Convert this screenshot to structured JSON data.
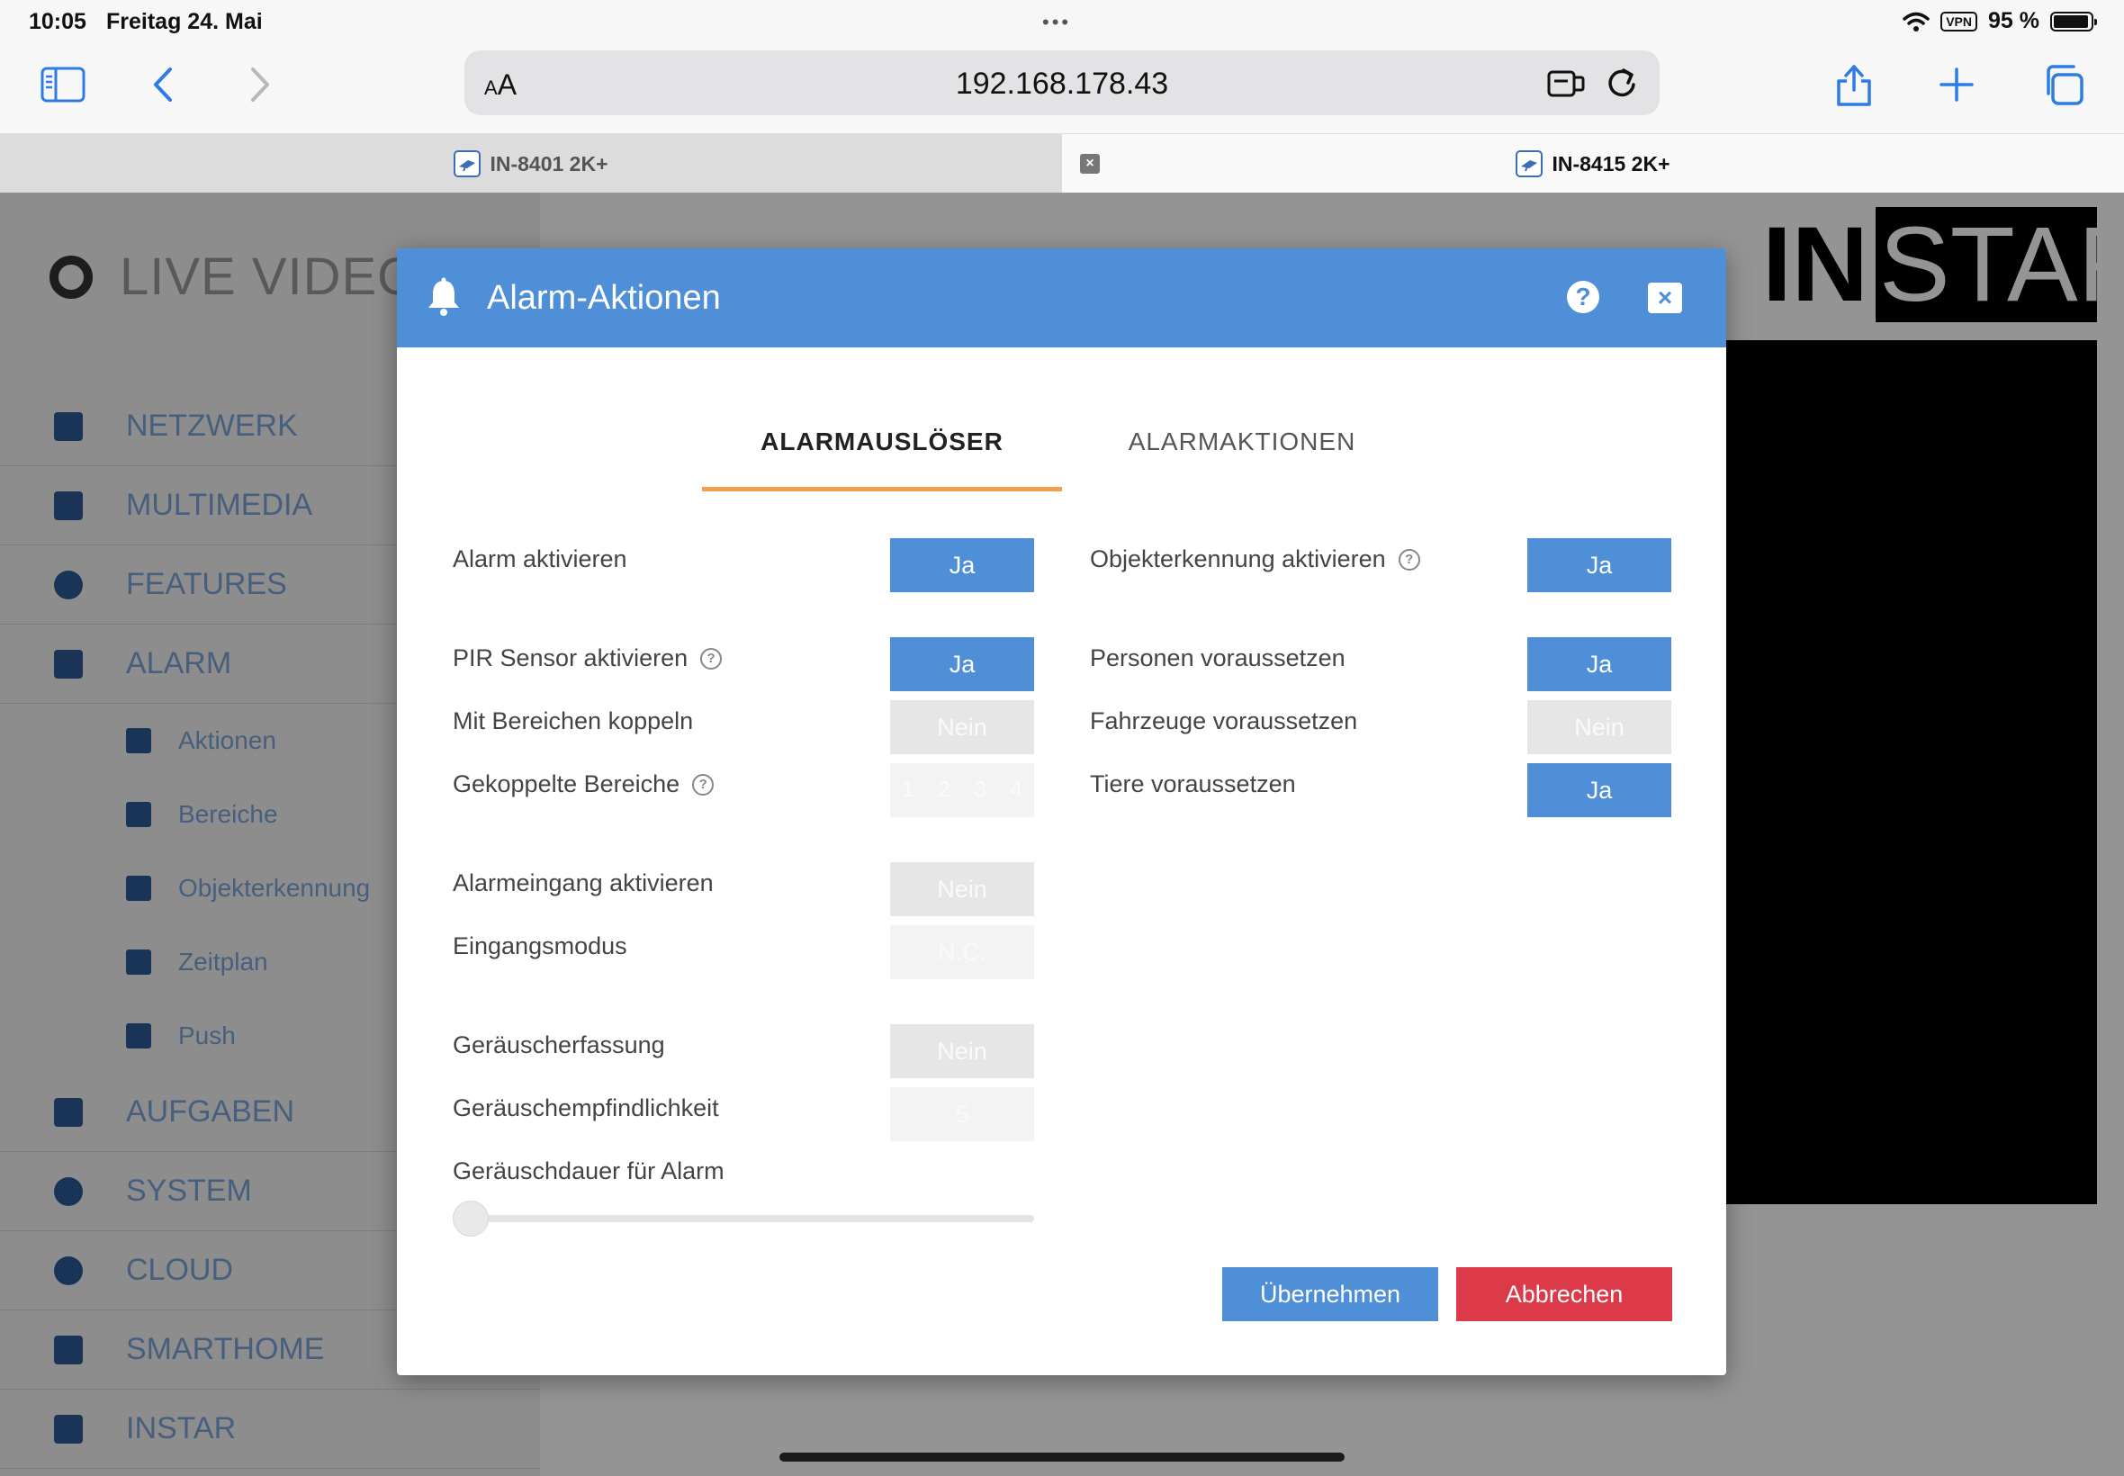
{
  "status_bar": {
    "time": "10:05",
    "date": "Freitag 24. Mai",
    "vpn": "VPN",
    "battery": "95 %"
  },
  "browser": {
    "aa": "AA",
    "url": "192.168.178.43",
    "tabs": [
      {
        "label": "IN-8401 2K+",
        "active": false
      },
      {
        "label": "IN-8415 2K+",
        "active": true
      }
    ]
  },
  "background_page": {
    "title": "LIVE VIDEO",
    "menu": [
      "NETZWERK",
      "MULTIMEDIA",
      "FEATURES",
      "ALARM"
    ],
    "submenu": [
      "Aktionen",
      "Bereiche",
      "Objekterkennung",
      "Zeitplan",
      "Push"
    ],
    "menu2": [
      "AUFGABEN",
      "SYSTEM",
      "CLOUD",
      "SMARTHOME",
      "INSTAR"
    ],
    "logo": {
      "part1": "IN",
      "part2": "STAR"
    }
  },
  "modal": {
    "title": "Alarm-Aktionen",
    "help": "?",
    "close": "×",
    "tabs": [
      "ALARMAUSLÖSER",
      "ALARMAKTIONEN"
    ],
    "left": {
      "alarm_enable": {
        "label": "Alarm aktivieren",
        "value": "Ja"
      },
      "pir_enable": {
        "label": "PIR Sensor aktivieren",
        "value": "Ja"
      },
      "couple_areas": {
        "label": "Mit Bereichen koppeln",
        "value": "Nein"
      },
      "coupled_areas": {
        "label": "Gekoppelte Bereiche",
        "areas": [
          "1",
          "2",
          "3",
          "4"
        ]
      },
      "alarm_input": {
        "label": "Alarmeingang aktivieren",
        "value": "Nein"
      },
      "input_mode": {
        "label": "Eingangsmodus",
        "value": "N.C."
      },
      "noise_detect": {
        "label": "Geräuscherfassung",
        "value": "Nein"
      },
      "noise_sensitivity": {
        "label": "Geräuschempfindlichkeit",
        "value": "5"
      },
      "noise_duration": {
        "label": "Geräuschdauer für Alarm"
      }
    },
    "right": {
      "object_detect": {
        "label": "Objekterkennung aktivieren",
        "value": "Ja"
      },
      "persons": {
        "label": "Personen voraussetzen",
        "value": "Ja"
      },
      "vehicles": {
        "label": "Fahrzeuge voraussetzen",
        "value": "Nein"
      },
      "animals": {
        "label": "Tiere voraussetzen",
        "value": "Ja"
      }
    },
    "buttons": {
      "apply": "Übernehmen",
      "cancel": "Abbrechen"
    }
  },
  "colors": {
    "accent": "#4f8fd8",
    "tab_underline": "#f0a04b",
    "cancel": "#dc3a48"
  }
}
